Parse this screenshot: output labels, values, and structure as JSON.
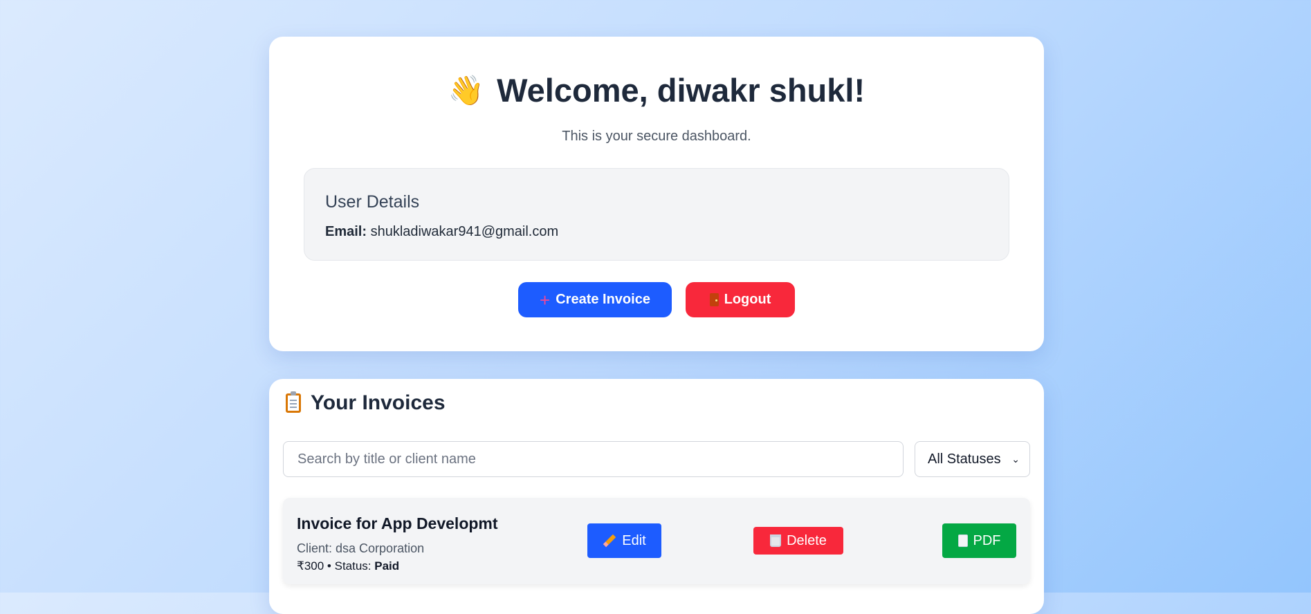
{
  "welcome": {
    "emoji": "👋",
    "title": "Welcome, diwakr shukl!",
    "subtitle": "This is your secure dashboard."
  },
  "user_details": {
    "heading": "User Details",
    "email_label": "Email:",
    "email_value": "shukladiwakar941@gmail.com"
  },
  "actions": {
    "create_label": "Create Invoice",
    "create_icon": "plus-icon",
    "logout_label": "Logout",
    "logout_icon": "door-icon",
    "create_color": "#1d5cff",
    "logout_color": "#f8283b"
  },
  "invoices": {
    "heading": "Your Invoices",
    "heading_icon": "clipboard-icon",
    "search_placeholder": "Search by title or client name",
    "status_filter": "All Statuses",
    "items": [
      {
        "title": "Invoice for App Developmt",
        "client_label": "Client: dsa Corporation",
        "amount": "₹300",
        "separator": "•",
        "status_label": "Status:",
        "status": "Paid",
        "edit_label": "Edit",
        "delete_label": "Delete",
        "pdf_label": "PDF"
      }
    ]
  }
}
